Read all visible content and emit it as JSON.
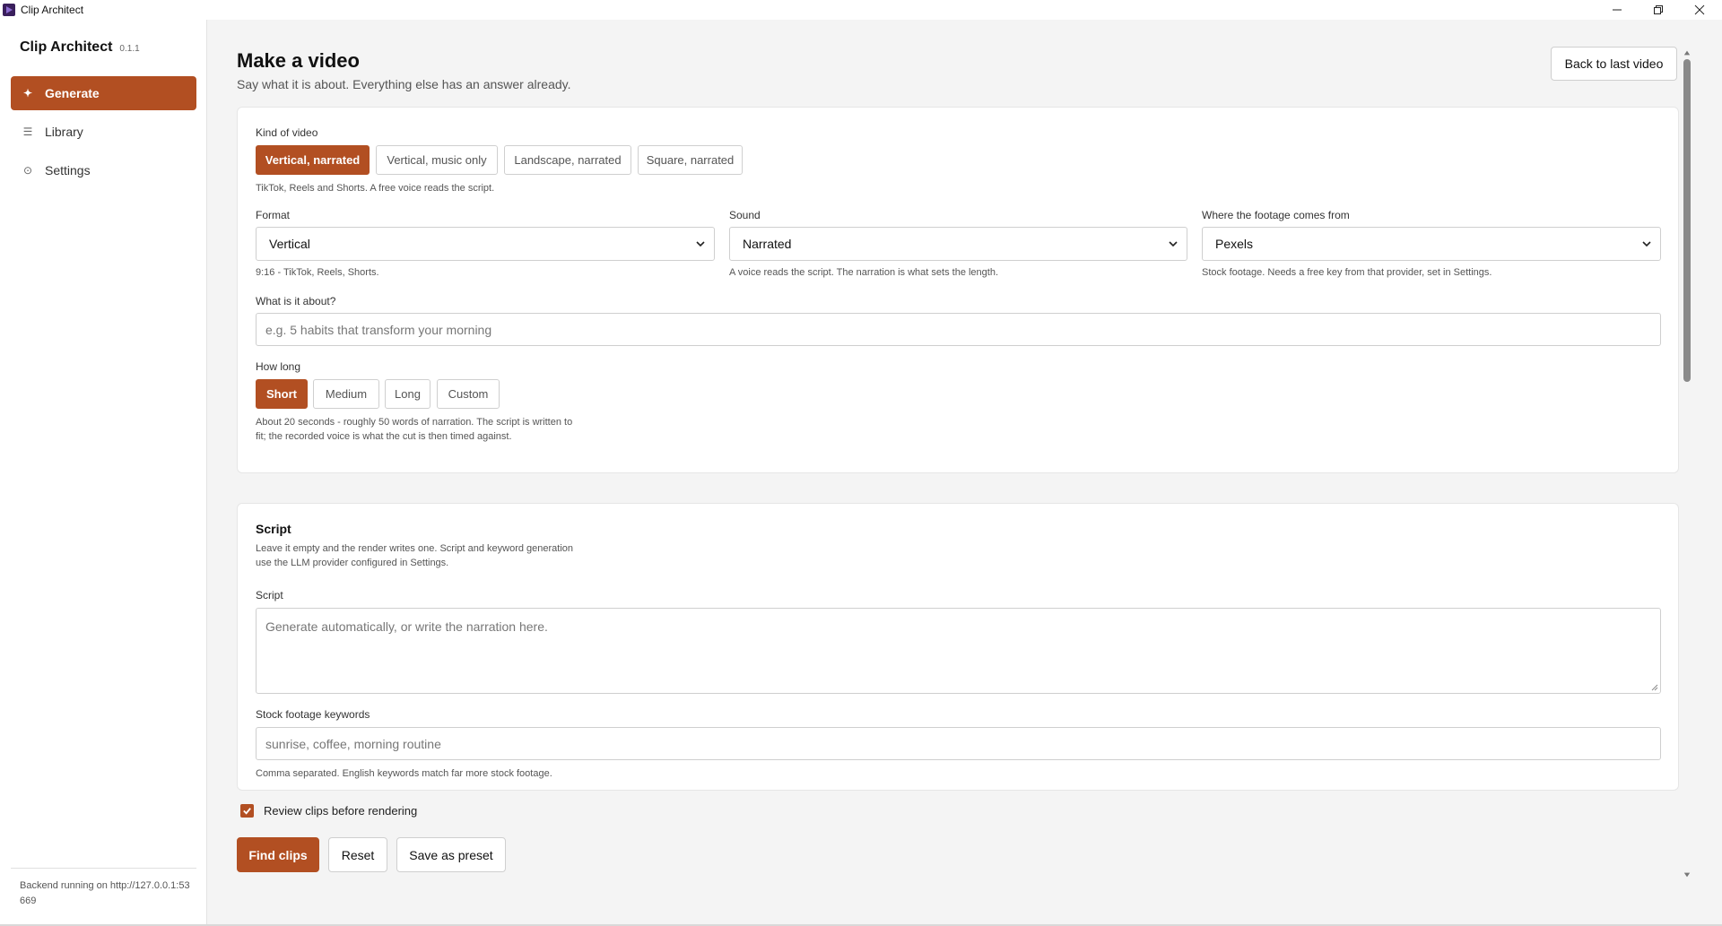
{
  "window": {
    "title": "Clip Architect"
  },
  "sidebar": {
    "app_name": "Clip Architect",
    "version": "0.1.1",
    "items": [
      {
        "label": "Generate",
        "icon": "sparkle-icon",
        "active": true
      },
      {
        "label": "Library",
        "icon": "list-icon",
        "active": false
      },
      {
        "label": "Settings",
        "icon": "gear-icon",
        "active": false
      }
    ],
    "backend_status": "Backend running on http://127.0.0.1:53669"
  },
  "header": {
    "title": "Make a video",
    "subtitle": "Say what it is about. Everything else has an answer already.",
    "back_button": "Back to last video"
  },
  "video_settings": {
    "kind_label": "Kind of video",
    "kinds": [
      "Vertical, narrated",
      "Vertical, music only",
      "Landscape, narrated",
      "Square, narrated"
    ],
    "kind_selected": "Vertical, narrated",
    "kind_hint": "TikTok, Reels and Shorts. A free voice reads the script.",
    "format": {
      "label": "Format",
      "value": "Vertical",
      "hint": "9:16 - TikTok, Reels, Shorts."
    },
    "sound": {
      "label": "Sound",
      "value": "Narrated",
      "hint": "A voice reads the script. The narration is what sets the length."
    },
    "footage": {
      "label": "Where the footage comes from",
      "value": "Pexels",
      "hint": "Stock footage. Needs a free key from that provider, set in Settings."
    },
    "topic": {
      "label": "What is it about?",
      "value": "",
      "placeholder": "e.g. 5 habits that transform your morning"
    },
    "length_label": "How long",
    "lengths": [
      "Short",
      "Medium",
      "Long",
      "Custom"
    ],
    "length_selected": "Short",
    "length_hint_1": "About 20 seconds - roughly 50 words of narration. The script is written to",
    "length_hint_2": "fit; the recorded voice is what the cut is then timed against."
  },
  "script_section": {
    "title": "Script",
    "description_1": "Leave it empty and the render writes one. Script and keyword generation",
    "description_2": "use the LLM provider configured in Settings.",
    "script_label": "Script",
    "script_placeholder": "Generate automatically, or write the narration here.",
    "keywords_label": "Stock footage keywords",
    "keywords_placeholder": "sunrise, coffee, morning routine",
    "keywords_hint": "Comma separated. English keywords match far more stock footage."
  },
  "actions": {
    "review_label": "Review clips before rendering",
    "review_checked": true,
    "find_clips": "Find clips",
    "reset": "Reset",
    "save_preset": "Save as preset"
  },
  "colors": {
    "accent": "#b24f22",
    "background": "#f4f4f4",
    "card": "#ffffff"
  }
}
